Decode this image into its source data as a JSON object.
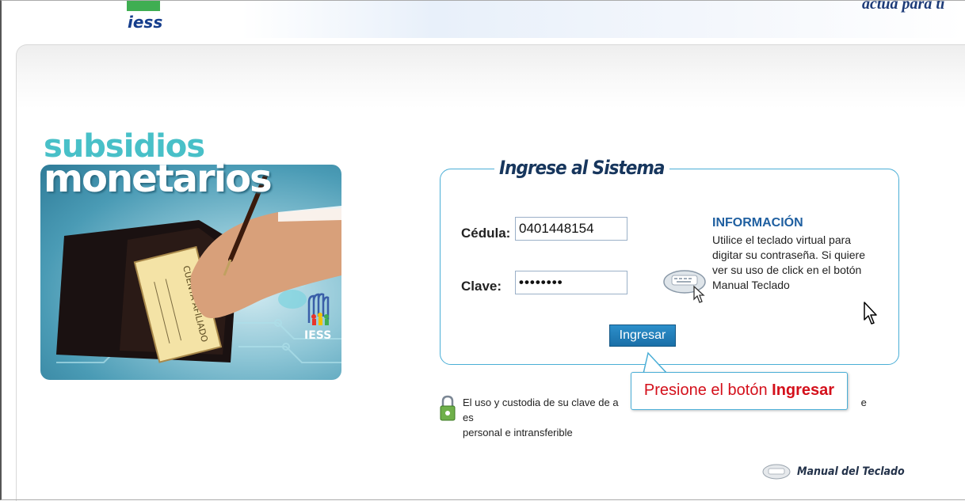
{
  "header": {
    "logo_text": "iess",
    "slogan": "actúa para ti"
  },
  "banner": {
    "title_line1": "subsidios",
    "title_line2": "monetarios",
    "logo_text": "IESS",
    "card_text": "CUENTA AFILIADO"
  },
  "login": {
    "legend": "Ingrese al Sistema",
    "cedula_label": "Cédula:",
    "cedula_value": "0401448154",
    "clave_label": "Clave:",
    "clave_value": "••••••••",
    "submit_label": "Ingresar",
    "info_title": "INFORMACIÓN",
    "info_text": "Utilice el teclado virtual para digitar su contraseña. Si quiere ver su uso de click en el botón Manual Teclado"
  },
  "callout": {
    "prefix": "Presione el botón ",
    "strong": "Ingresar"
  },
  "note": {
    "line1_visible": "El uso y custodia de su clave de a",
    "line1_end": "e es",
    "line2": "personal e intransferible"
  },
  "manual": {
    "label": "Manual del Teclado"
  },
  "colors": {
    "accent": "#4aaed6",
    "button": "#1a6fa8",
    "callout_text": "#d4101b",
    "title": "#17365d"
  },
  "icons": [
    "keyboard-icon",
    "lock-icon",
    "cursor-icon",
    "iess-logo-icon"
  ]
}
